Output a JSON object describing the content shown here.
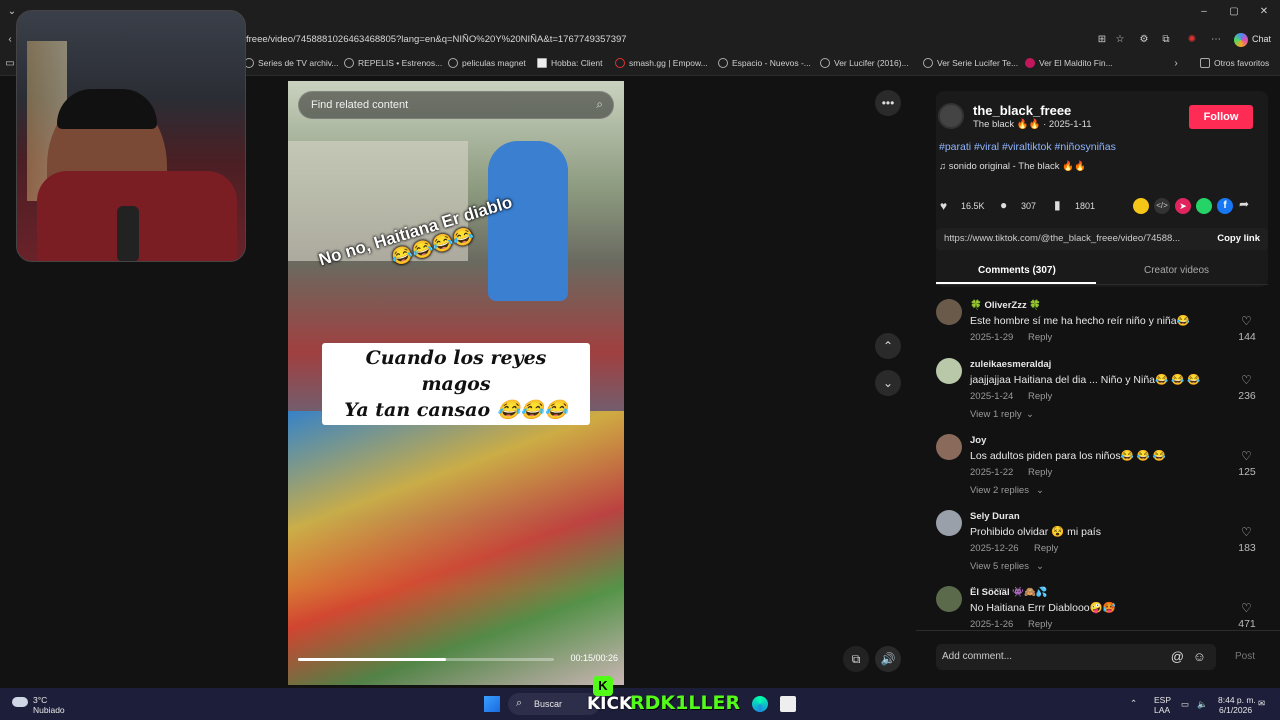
{
  "browser": {
    "url": "freee/video/7458881026463468805?lang=en&q=NIÑO%20Y%20NIÑA&t=1767749357397",
    "chat_label": "Chat",
    "favorites": [
      "Series de TV archiv...",
      "REPELIS • Estrenos...",
      "peliculas magnet",
      "Hobba: Client",
      "smash.gg | Empow...",
      "Espacio - Nuevos -...",
      "Ver Lucifer (2016)...",
      "Ver Serie Lucifer Te...",
      "Ver El Maldito Fin..."
    ],
    "other_favorites": "Otros favoritos"
  },
  "video": {
    "search_placeholder": "Find related content",
    "overlay_text": "No no, Haitiana Er diablo",
    "overlay_emoji": "😂😂😂😂",
    "caption_line1": "Cuando los reyes magos",
    "caption_line2": "Ya tan cansao 😂😂😂",
    "time": "00:15/00:26",
    "progress_fraction": 0.58
  },
  "post": {
    "username": "the_black_freee",
    "display_line": "The black 🔥🔥 · 2025-1-11",
    "follow_label": "Follow",
    "hashtags": "#parati #viral #viraltiktok #niñosyniñas",
    "sound": "sonido original - The black 🔥🔥",
    "likes": "16.5K",
    "comments": "307",
    "saves": "1801",
    "link": "https://www.tiktok.com/@the_black_freee/video/74588...",
    "copy_link": "Copy link",
    "tab_comments": "Comments (307)",
    "tab_creator": "Creator videos",
    "add_comment_placeholder": "Add comment...",
    "post_label": "Post"
  },
  "comments": [
    {
      "user": "🍀 OliverZzz 🍀",
      "text": "Este hombre sí me ha hecho reír niño y niña😂",
      "date": "2025-1-29",
      "reply": "Reply",
      "likes": "144",
      "view_replies": ""
    },
    {
      "user": "zuleikaesmeraldaj",
      "text": "jaajjajjaa Haitiana del dia ... Niño y Niña😂 😂 😂",
      "date": "2025-1-24",
      "reply": "Reply",
      "likes": "236",
      "view_replies": "View 1 reply"
    },
    {
      "user": "Joy",
      "text": "Los adultos piden para los niños😂 😂 😂",
      "date": "2025-1-22",
      "reply": "Reply",
      "likes": "125",
      "view_replies": "View 2 replies"
    },
    {
      "user": "Sely Duran",
      "text": "Prohibido olvidar 😵 mi país",
      "date": "2025-12-26",
      "reply": "Reply",
      "likes": "183",
      "view_replies": "View 5 replies"
    },
    {
      "user": "Ël Söčïäl 👾🙈💦",
      "text": "No Haitiana Errr Diablooo🤪🥵",
      "date": "2025-1-26",
      "reply": "Reply",
      "likes": "471",
      "view_replies": ""
    }
  ],
  "taskbar": {
    "temp": "3°C",
    "weather": "Nubiado",
    "search": "Buscar",
    "streamer_overlay": "RDK1LLER",
    "kick": "KICK",
    "lang1": "ESP",
    "lang2": "LAA",
    "clock_time": "8:44 p. m.",
    "clock_date": "6/1/2026"
  }
}
